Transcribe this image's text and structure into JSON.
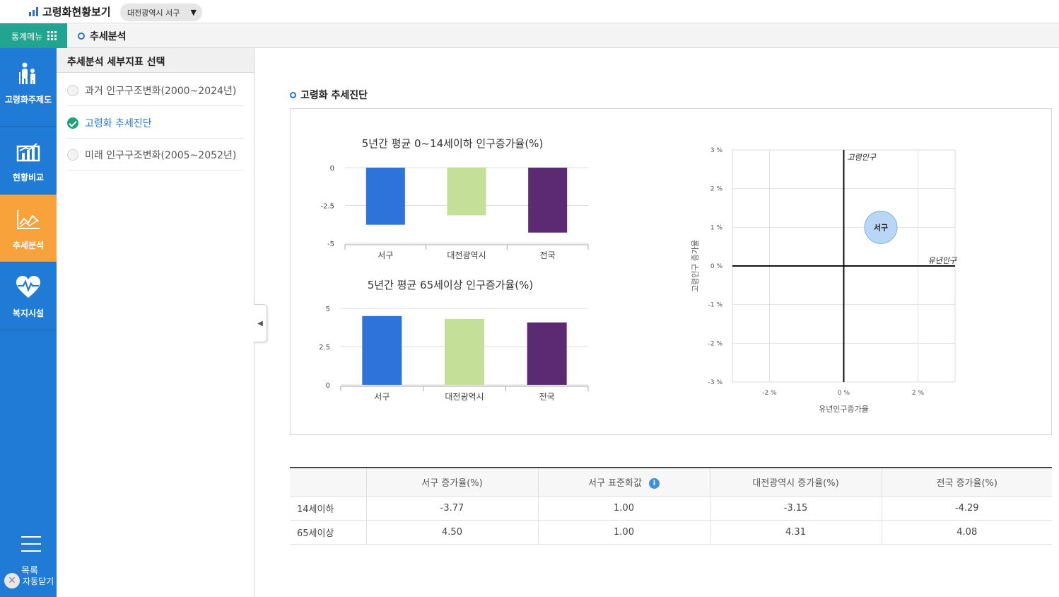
{
  "header": {
    "app_title": "고령화현황보기",
    "region": "대전광역시 서구",
    "caret": "▼"
  },
  "menubar": {
    "menu_label": "통계메뉴",
    "breadcrumb": "추세분석"
  },
  "leftnav": {
    "items": [
      {
        "label": "고령화주제도",
        "icon": "elderly-people-icon",
        "active": false
      },
      {
        "label": "현황비교",
        "icon": "bar-chart-icon",
        "active": false
      },
      {
        "label": "추세분석",
        "icon": "line-chart-icon",
        "active": true
      },
      {
        "label": "복지시설",
        "icon": "heart-pulse-icon",
        "active": false
      }
    ],
    "list_label": "목록",
    "autoclose_label": "자동닫기",
    "close_glyph": "✕"
  },
  "subpanel": {
    "title": "추세분석 세부지표 선택",
    "options": [
      {
        "label": "과거 인구구조변화(2000~2024년)",
        "selected": false
      },
      {
        "label": "고령화 추세진단",
        "selected": true
      },
      {
        "label": "미래 인구구조변화(2005~2052년)",
        "selected": false
      }
    ],
    "collapse_glyph": "◀"
  },
  "main": {
    "section_title": "고령화 추세진단"
  },
  "chart_data": [
    {
      "type": "bar",
      "title": "5년간 평균 0~14세이하 인구증가율(%)",
      "categories": [
        "서구",
        "대전광역시",
        "전국"
      ],
      "values": [
        -3.77,
        -3.15,
        -4.29
      ],
      "colors": [
        "#2e73d9",
        "#c3df98",
        "#5b2a73"
      ],
      "ylim": [
        -5,
        0
      ],
      "yticks": [
        0,
        -2.5,
        -5
      ],
      "ytick_labels": [
        "0",
        "-2.5",
        "-5"
      ]
    },
    {
      "type": "bar",
      "title": "5년간 평균 65세이상 인구증가율(%)",
      "categories": [
        "서구",
        "대전광역시",
        "전국"
      ],
      "values": [
        4.5,
        4.31,
        4.08
      ],
      "colors": [
        "#2e73d9",
        "#c3df98",
        "#5b2a73"
      ],
      "ylim": [
        0,
        5
      ],
      "yticks": [
        5,
        2.5,
        0
      ],
      "ytick_labels": [
        "5",
        "2.5",
        "0"
      ]
    },
    {
      "type": "scatter",
      "xlabel": "유년인구증가율",
      "ylabel": "고령인구 증가율",
      "xlim": [
        -3,
        3
      ],
      "ylim": [
        -3,
        3
      ],
      "xticks": [
        -2,
        0,
        2
      ],
      "xtick_labels": [
        "-2 %",
        "0 %",
        "2 %"
      ],
      "yticks": [
        3,
        2,
        1,
        0,
        -1,
        -2,
        -3
      ],
      "ytick_labels": [
        "3 %",
        "2 %",
        "1 %",
        "0 %",
        "-1 %",
        "-2 %",
        "-3 %"
      ],
      "points": [
        {
          "label": "서구",
          "x": 1.0,
          "y": 1.0
        }
      ],
      "quadrant_labels": {
        "y_axis": "고령인구",
        "x_axis": "유년인구"
      },
      "grid": true
    }
  ],
  "table": {
    "headers": [
      "",
      "서구 증가율(%)",
      "서구 표준화값",
      "대전광역시 증가율(%)",
      "전국 증가율(%)"
    ],
    "info_glyph": "i",
    "rows": [
      [
        "14세이하",
        "-3.77",
        "1.00",
        "-3.15",
        "-4.29"
      ],
      [
        "65세이상",
        "4.50",
        "1.00",
        "4.31",
        "4.08"
      ]
    ]
  }
}
